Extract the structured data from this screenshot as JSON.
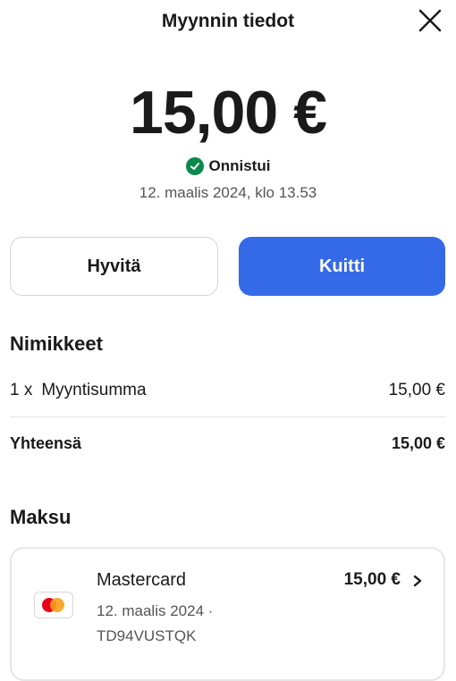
{
  "header": {
    "title": "Myynnin tiedot",
    "close_icon": "close-icon"
  },
  "sale": {
    "amount": "15,00 €",
    "status": "Onnistui",
    "status_color": "#0a8a4c",
    "timestamp": "12. maalis 2024, klo 13.53"
  },
  "actions": {
    "refund_label": "Hyvitä",
    "receipt_label": "Kuitti",
    "accent_color": "#3469e8"
  },
  "items": {
    "title": "Nimikkeet",
    "rows": [
      {
        "qty": "1 x",
        "name": "Myyntisumma",
        "price": "15,00 €"
      }
    ],
    "total_label": "Yhteensä",
    "total_value": "15,00 €"
  },
  "payment": {
    "title": "Maksu",
    "card_brand": "Mastercard",
    "date": "12. maalis 2024 ·",
    "reference": "TD94VUSTQK",
    "amount": "15,00 €",
    "icon": "mastercard-icon",
    "chevron_icon": "chevron-right-icon"
  }
}
